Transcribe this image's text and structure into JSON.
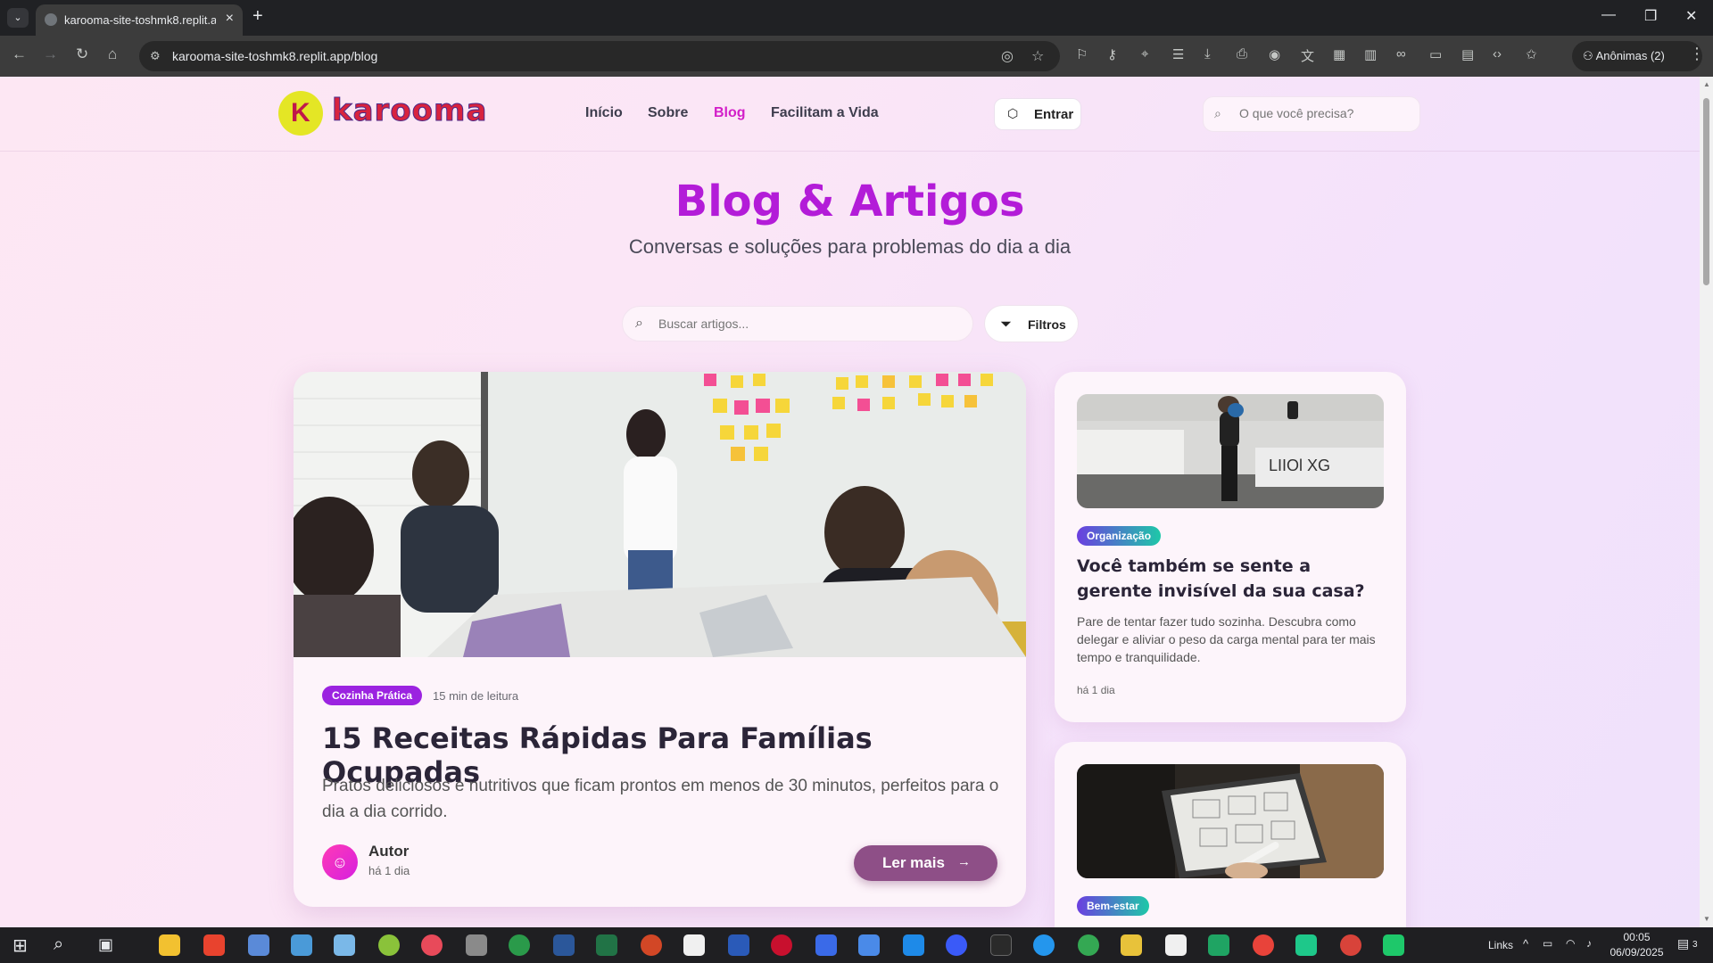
{
  "browser": {
    "tab_title": "karooma-site-toshmk8.replit.app",
    "url": "karooma-site-toshmk8.replit.app/blog",
    "profile_label": "Anônimas (2)"
  },
  "header": {
    "logo_text": "karooma",
    "logo_mark": "K",
    "nav": [
      {
        "label": "Início"
      },
      {
        "label": "Sobre"
      },
      {
        "label": "Blog"
      },
      {
        "label": "Facilitam a Vida"
      }
    ],
    "login_label": "Entrar",
    "search_placeholder": "O que você precisa?"
  },
  "hero": {
    "title": "Blog & Artigos",
    "subtitle": "Conversas e soluções para problemas do dia a dia"
  },
  "article_search": {
    "placeholder": "Buscar artigos...",
    "filter_label": "Filtros"
  },
  "featured": {
    "category": "Cozinha Prática",
    "category_color": "#9b23e0",
    "read_time": "15 min de leitura",
    "title": "15 Receitas Rápidas Para Famílias Ocupadas",
    "excerpt": "Pratos deliciosos e nutritivos que ficam prontos em menos de 30 minutos, perfeitos para o dia a dia corrido.",
    "author": "Autor",
    "posted": "há 1 dia",
    "read_more": "Ler mais"
  },
  "side_cards": [
    {
      "category": "Organização",
      "category_color": "#6b3fe0",
      "title": "Você também se sente a gerente invisível da sua casa?",
      "excerpt": "Pare de tentar fazer tudo sozinha. Descubra como delegar e aliviar o peso da carga mental para ter mais tempo e tranquilidade.",
      "date": "há 1 dia"
    },
    {
      "category": "Bem-estar",
      "category_color": "#6b3fe0"
    }
  ],
  "taskbar": {
    "links_label": "Links",
    "time": "00:05",
    "date": "06/09/2025",
    "notif_count": "3"
  },
  "colors": {
    "accent": "#b31cd8",
    "nav_active": "#d21ec8",
    "read_more_bg": "#8e4f87"
  }
}
